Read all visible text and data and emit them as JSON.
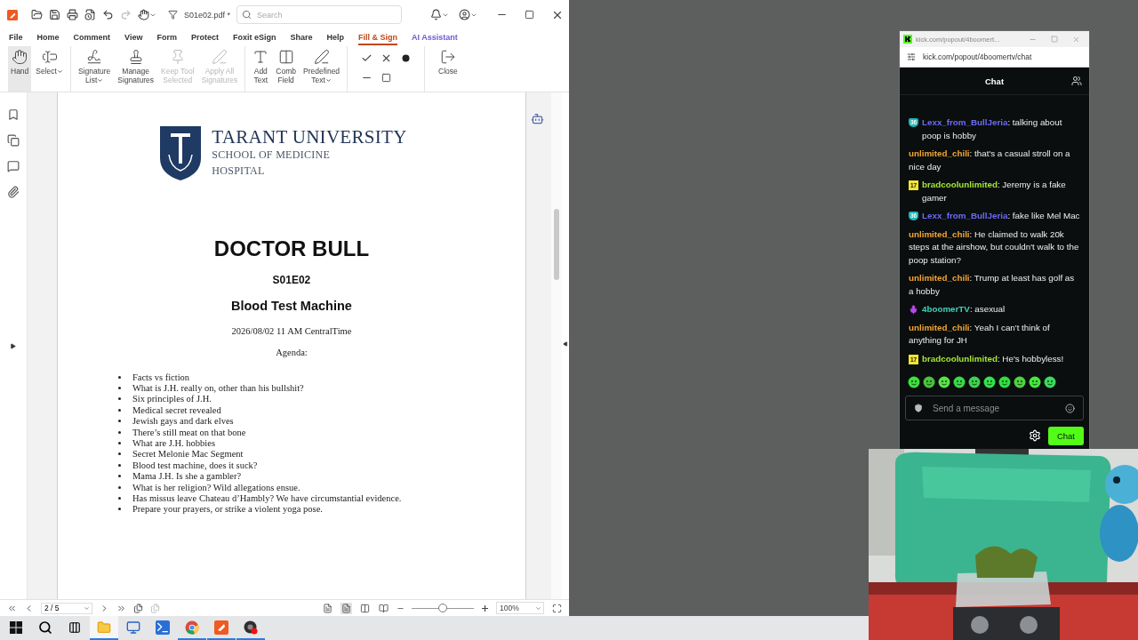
{
  "pdf_window": {
    "filename": "S01e02.pdf *",
    "search": {
      "placeholder": "Search"
    },
    "menu": [
      {
        "label": "File",
        "kind": "tab",
        "selected": false
      },
      {
        "label": "Home",
        "kind": "tab",
        "selected": false
      },
      {
        "label": "Comment",
        "kind": "tab",
        "selected": false
      },
      {
        "label": "View",
        "kind": "tab",
        "selected": false
      },
      {
        "label": "Form",
        "kind": "tab",
        "selected": false
      },
      {
        "label": "Protect",
        "kind": "tab",
        "selected": false
      },
      {
        "label": "Foxit eSign",
        "kind": "tab",
        "selected": false
      },
      {
        "label": "Share",
        "kind": "tab",
        "selected": false
      },
      {
        "label": "Help",
        "kind": "tab",
        "selected": false
      },
      {
        "label": "Fill & Sign",
        "kind": "tab",
        "selected": true
      },
      {
        "label": "AI Assistant",
        "kind": "ai",
        "selected": false
      }
    ],
    "tool_groups": [
      [
        {
          "label": "Hand",
          "selected": true,
          "disabled": false,
          "dropdown": false
        },
        {
          "label": "Select",
          "selected": false,
          "disabled": false,
          "dropdown": true
        }
      ],
      [
        {
          "label": "Signature\nList",
          "selected": false,
          "disabled": false,
          "dropdown": true
        },
        {
          "label": "Manage\nSignatures",
          "selected": false,
          "disabled": false,
          "dropdown": false
        },
        {
          "label": "Keep Tool\nSelected",
          "selected": false,
          "disabled": true,
          "dropdown": false
        },
        {
          "label": "Apply All\nSignatures",
          "selected": false,
          "disabled": true,
          "dropdown": false
        }
      ],
      [
        {
          "label": "Add\nText",
          "selected": false,
          "disabled": false,
          "dropdown": false
        },
        {
          "label": "Comb\nField",
          "selected": false,
          "disabled": false,
          "dropdown": false
        },
        {
          "label": "Predefined\nText",
          "selected": false,
          "disabled": false,
          "dropdown": true
        }
      ],
      [
        {
          "label": "Close",
          "selected": false,
          "disabled": false,
          "dropdown": false
        }
      ]
    ],
    "page_nav": {
      "value": "2 / 5"
    },
    "zoom": {
      "value": "100%",
      "level": 0.5
    },
    "document": {
      "logo": {
        "name": "TARANT UNIVERSITY",
        "school": "SCHOOL OF MEDICINE",
        "unit": "HOSPITAL"
      },
      "title": "DOCTOR BULL",
      "episode": "S01E02",
      "subtitle": "Blood Test Machine",
      "date": "2026/08/02 11 AM CentralTime",
      "agenda_label": "Agenda:",
      "agenda": [
        "Facts vs fiction",
        "What is J.H. really on, other than his bullshit?",
        "Six principles of J.H.",
        "Medical secret revealed",
        "Jewish gays and dark elves",
        "There’s still meat on that bone",
        "What are J.H. hobbies",
        "Secret Melonie Mac Segment",
        "Blood test machine, does it suck?",
        "Mama J.H. Is she a gambler?",
        "What is her religion? Wild allegations ensue.",
        "Has missus leave Chateau d’Hambly? We have circumstantial evidence.",
        "Prepare your prayers, or strike a violent yoga pose."
      ]
    }
  },
  "chat_window": {
    "tab_title": "kick.com/popout/4boomert...",
    "url": "kick.com/popout/4boomertv/chat",
    "header": "Chat",
    "messages": [
      {
        "badge": {
          "kind": "shield",
          "text": "36"
        },
        "user": "Lexx_from_BullJeria",
        "color": "#6a6cf6",
        "text": ": talking about poop is hobby"
      },
      {
        "user": "unlimited_chili",
        "color": "#f2a531",
        "text": ": that's a casual stroll on a nice day"
      },
      {
        "badge": {
          "kind": "square",
          "text": "17"
        },
        "user": "bradcoolunlimited",
        "color": "#a4e832",
        "text": ": Jeremy is a fake gamer"
      },
      {
        "badge": {
          "kind": "shield",
          "text": "36"
        },
        "user": "Lexx_from_BullJeria",
        "color": "#6a6cf6",
        "text": ": fake like Mel Mac"
      },
      {
        "user": "unlimited_chili",
        "color": "#f2a531",
        "text": ": He claimed to walk 20k steps at the airshow, but couldn't walk to the poop station?"
      },
      {
        "user": "unlimited_chili",
        "color": "#f2a531",
        "text": ": Trump at least has golf as a hobby"
      },
      {
        "badge": {
          "kind": "mic"
        },
        "user": "4boomerTV",
        "color": "#3fd1b8",
        "text": ": asexual"
      },
      {
        "user": "unlimited_chili",
        "color": "#f2a531",
        "text": ": Yeah I can't think of anything for JH"
      },
      {
        "badge": {
          "kind": "square",
          "text": "17"
        },
        "user": "bradcoolunlimited",
        "color": "#a4e832",
        "text": ": He's hobbyless!"
      }
    ],
    "input": {
      "placeholder": "Send a message"
    },
    "send_label": "Chat"
  },
  "taskbar": {
    "apps": [
      {
        "kind": "explorer",
        "selected": true,
        "running": true
      },
      {
        "kind": "remote",
        "selected": false,
        "running": false
      },
      {
        "kind": "shell",
        "selected": false,
        "running": false
      },
      {
        "kind": "browser",
        "selected": false,
        "running": true
      },
      {
        "kind": "reader",
        "selected": false,
        "running": true
      },
      {
        "kind": "recorder",
        "selected": false,
        "running": true
      }
    ]
  }
}
